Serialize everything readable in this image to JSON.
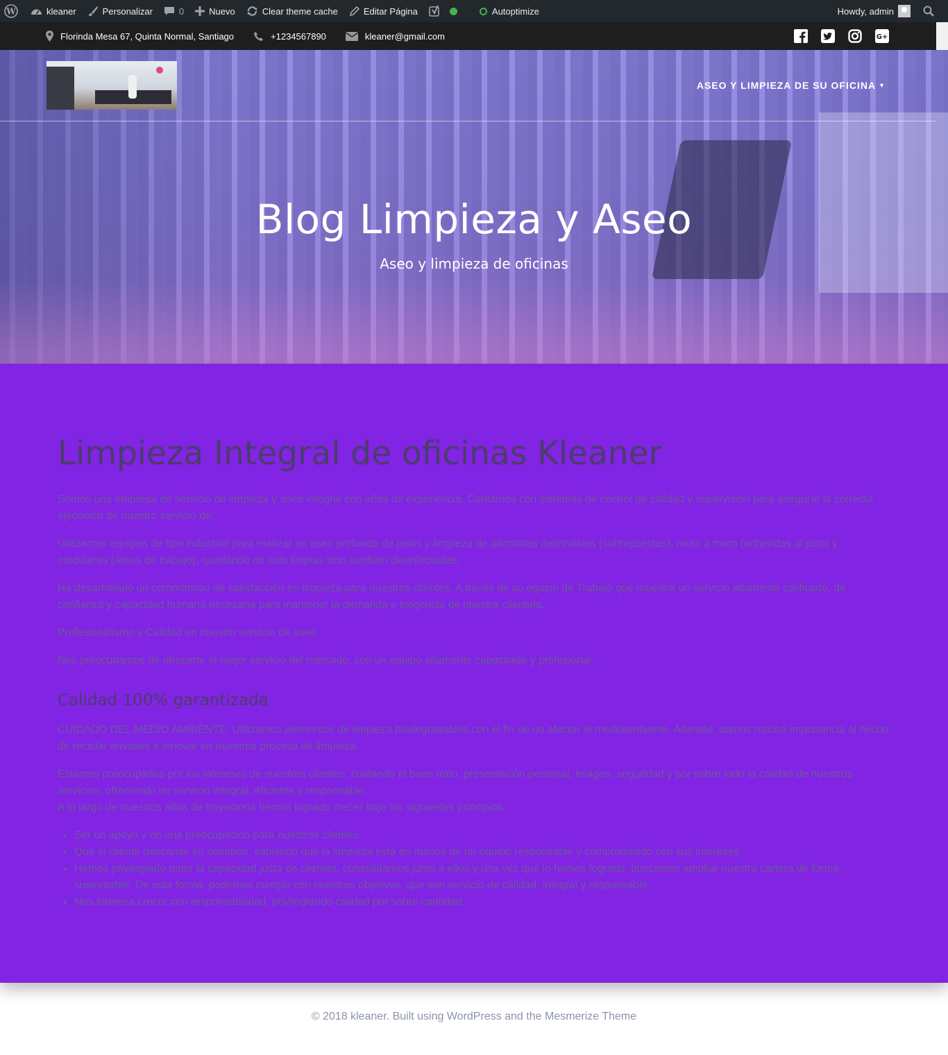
{
  "adminbar": {
    "site": "kleaner",
    "customize": "Personalizar",
    "comments_count": "0",
    "new": "Nuevo",
    "clear_cache": "Clear theme cache",
    "edit_page": "Editar Página",
    "autoptimize": "Autoptimize",
    "howdy": "Howdy, admin"
  },
  "infobar": {
    "address": "Florinda Mesa 67, Quinta Normal, Santiago",
    "phone": "+1234567890",
    "email": "kleaner@gmail.com",
    "social": [
      "facebook-icon",
      "twitter-icon",
      "instagram-icon",
      "google-plus-icon"
    ]
  },
  "header": {
    "menu_item": "ASEO Y LIMPIEZA DE SU OFICINA",
    "title": "Blog Limpieza y Aseo",
    "subtitle": "Aseo y limpieza de oficinas"
  },
  "content": {
    "heading": "Limpieza Integral de oficinas Kleaner",
    "paragraphs": [
      "Somos una empresa de servicio de limpieza y aseo integral con años de experiencia. Contamos con sistemas de control de calidad y supervisión para asegurar la correcta ejecución de nuestro servicio de.",
      "Utilizamos equipos de tipo industrial para realizar un aseo profunda de pisos y limpieza de alfombras decorativas (sobrepuestas), muro a muro (adheridas al piso) y modulares (áreas de trabajo), quedando no solo limpias sino también desinfectadas.",
      "Ha desarrollado un compromiso de satisfacción  en limpieza para nuestros clientes. A través de su equipo de Trabajo que muestra un servicio altamente calificado, de confianza y capacidad humana necesaria para mantener la demanda e exigencia de nuestra clientela.",
      "Profesionalismo y Calidad en nuestro servicio de aseo",
      "Nos preocupamos de ofrecerte el mejor servicio del mercado, con un equipo altamente capacitado y profesional."
    ],
    "subheading": "Calidad 100% garantizada",
    "paragraphs2": [
      "CUIDADO DEL MEDIO AMBIENTE: Utilizamos elementos de limpieza biodegradables con el fin de no afectar el medioambiente. Además, damos mucha importancia al hecho de reciclar envases e innovar en nuestros proceso de limpieza.",
      "Estamos preocupados por los intereses de nuestros clientes, cuidando el buen trato, presentación personal, imagen, seguridad y por sobre todo la calidad de nuestros servicios, ofreciendo un servicio integral, eficiente y responsable.",
      "A lo largo de nuestros años de trayectoria hemos logrado crecer bajo los siguientes principios:"
    ],
    "list": [
      "Ser un apoyo y no una preocupación para nuestros clientes.",
      "Que el cliente descanse en nosotros, sabiendo que la limpieza está en manos de un equipo responsable y comprometido con sus intereses.",
      "Hemos privilegiado tener la capacidad justa de clientes, consolidarnos junto a ellos y una vez que lo hemos logrado, buscamos ampliar nuestra cartera de forma sustentable. De esta forma, podemos cumplir con nuestros objetivos, que son servicio de calidad, integral y responsable.",
      "Nos interesa crecer con responsabilidad, privilegiando calidad por sobre cantidad"
    ]
  },
  "footer": {
    "text": "©  2018 kleaner. Built using WordPress and the Mesmerize Theme"
  },
  "colors": {
    "content_bg": "#8224e3",
    "adminbar_bg": "#23282d",
    "infobar_bg": "#1e1e1e"
  }
}
